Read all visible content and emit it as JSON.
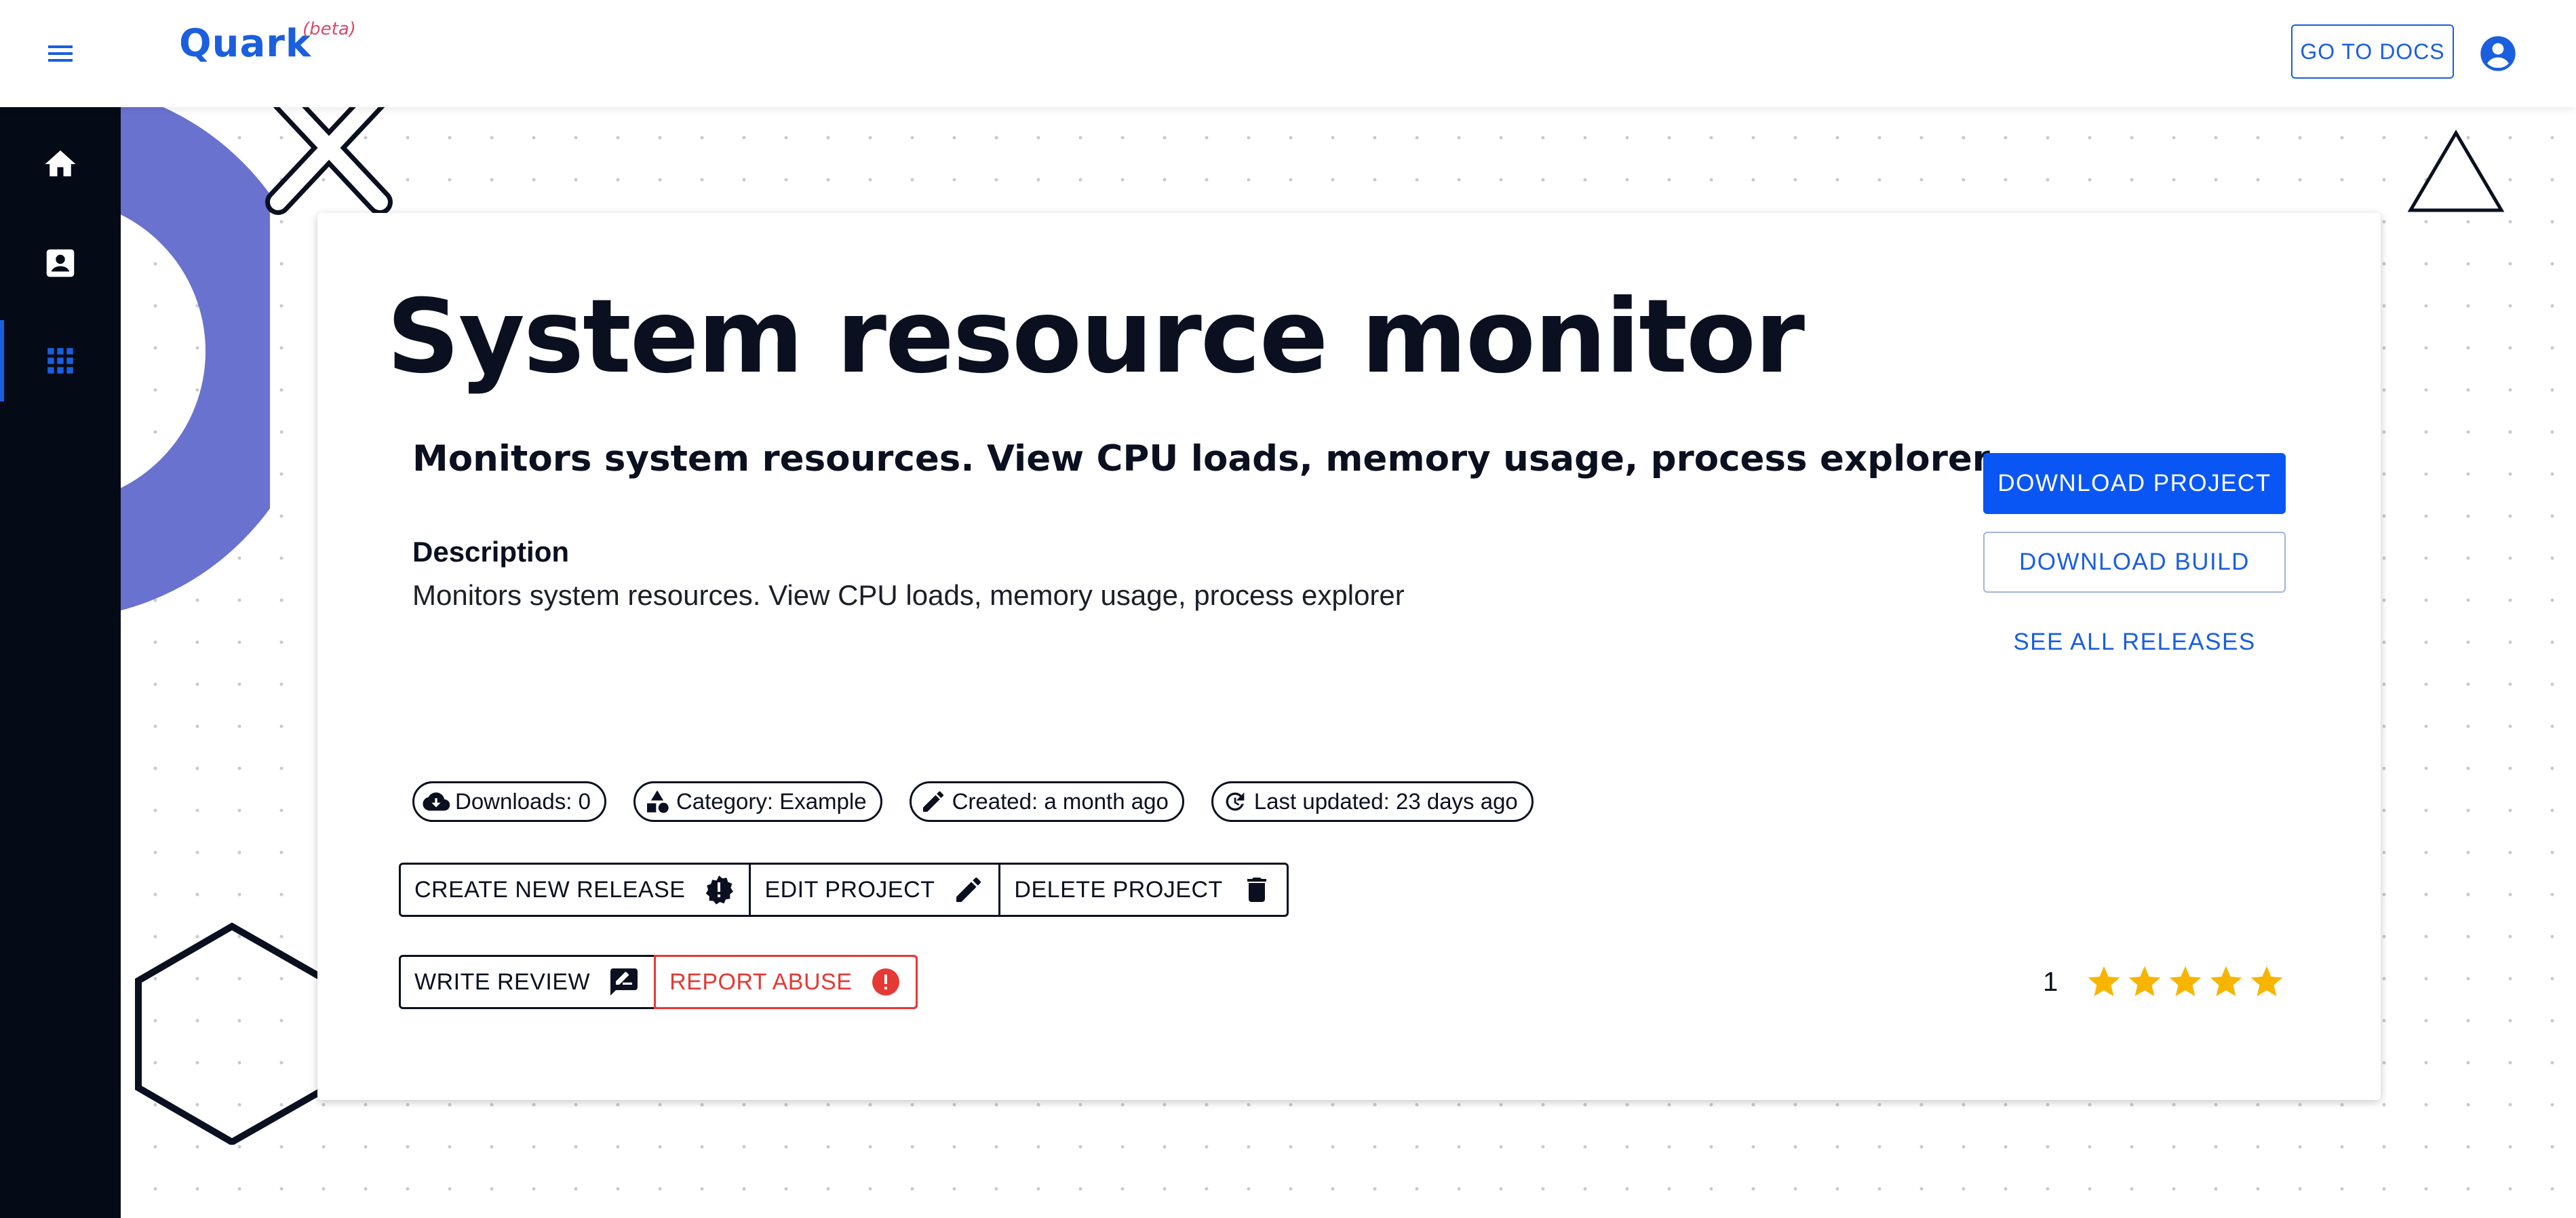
{
  "app": {
    "brand": "Quark",
    "badge": "(beta)",
    "docs_label": "GO TO DOCS"
  },
  "sidebar": {
    "items": [
      {
        "name": "home",
        "icon": "home-icon",
        "active": false
      },
      {
        "name": "profile",
        "icon": "contact-card-icon",
        "active": false
      },
      {
        "name": "projects",
        "icon": "apps-grid-icon",
        "active": true
      }
    ]
  },
  "project": {
    "title": "System resource monitor",
    "summary": "Monitors system resources. View CPU loads, memory usage, process explorer.",
    "description_heading": "Description",
    "description": "Monitors system resources. View CPU loads, memory usage, process explorer",
    "download_project_label": "DOWNLOAD PROJECT",
    "download_build_label": "DOWNLOAD BUILD",
    "see_releases_label": "SEE ALL RELEASES",
    "chips": {
      "downloads": "Downloads: 0",
      "category": "Category: Example",
      "created": "Created: a month ago",
      "updated": "Last updated: 23 days ago"
    },
    "actions": {
      "create_release": "CREATE NEW RELEASE",
      "edit": "EDIT PROJECT",
      "delete": "DELETE PROJECT",
      "write_review": "WRITE REVIEW",
      "report": "REPORT ABUSE"
    },
    "rating": {
      "count": "1",
      "stars": 5,
      "max_stars": 5
    }
  },
  "colors": {
    "primary": "#0a56f5",
    "brand": "#1a5fdd",
    "sidebar_bg": "#050a17",
    "danger": "#e53935",
    "star": "#f7b500",
    "decor_circle": "#6972cf"
  }
}
